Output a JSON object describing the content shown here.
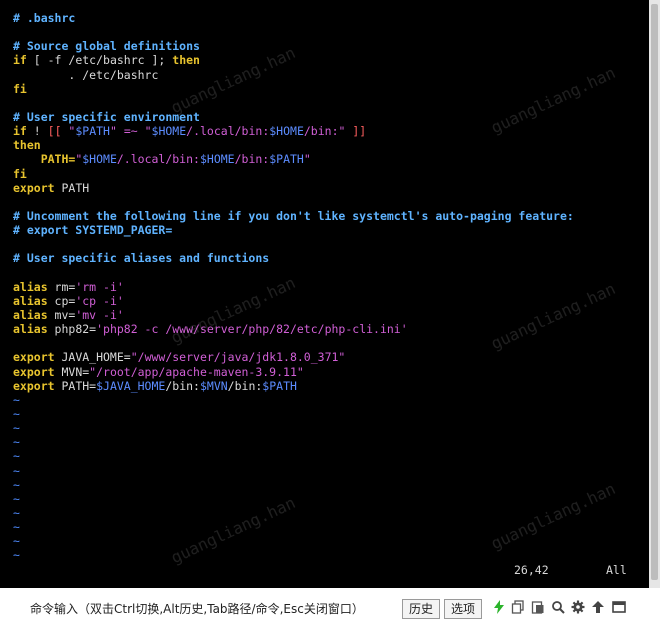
{
  "editor": {
    "lines": [
      [
        {
          "t": "# .bashrc",
          "c": "c-comment"
        }
      ],
      [],
      [
        {
          "t": "# Source global definitions",
          "c": "c-comment"
        }
      ],
      [
        {
          "t": "if",
          "c": "c-kw"
        },
        {
          "t": " [ -f /etc/bashrc ]; ",
          "c": "c-plain"
        },
        {
          "t": "then",
          "c": "c-kw"
        }
      ],
      [
        {
          "t": "        . /etc/bashrc",
          "c": "c-plain"
        }
      ],
      [
        {
          "t": "fi",
          "c": "c-kw"
        }
      ],
      [],
      [
        {
          "t": "# User specific environment",
          "c": "c-comment"
        }
      ],
      [
        {
          "t": "if",
          "c": "c-kw"
        },
        {
          "t": " ! ",
          "c": "c-plain"
        },
        {
          "t": "[[",
          "c": "c-red"
        },
        {
          "t": " \"",
          "c": "c-str"
        },
        {
          "t": "$PATH",
          "c": "c-var"
        },
        {
          "t": "\" =~ \"",
          "c": "c-str"
        },
        {
          "t": "$HOME",
          "c": "c-var"
        },
        {
          "t": "/.local/bin:",
          "c": "c-str"
        },
        {
          "t": "$HOME",
          "c": "c-var"
        },
        {
          "t": "/bin:\" ",
          "c": "c-str"
        },
        {
          "t": "]]",
          "c": "c-red"
        }
      ],
      [
        {
          "t": "then",
          "c": "c-kw"
        }
      ],
      [
        {
          "t": "    PATH=",
          "c": "c-kw"
        },
        {
          "t": "\"",
          "c": "c-str"
        },
        {
          "t": "$HOME",
          "c": "c-var"
        },
        {
          "t": "/.local/bin:",
          "c": "c-str"
        },
        {
          "t": "$HOME",
          "c": "c-var"
        },
        {
          "t": "/bin:",
          "c": "c-str"
        },
        {
          "t": "$PATH",
          "c": "c-var"
        },
        {
          "t": "\"",
          "c": "c-str"
        }
      ],
      [
        {
          "t": "fi",
          "c": "c-kw"
        }
      ],
      [
        {
          "t": "export",
          "c": "c-kw"
        },
        {
          "t": " PATH",
          "c": "c-plain"
        }
      ],
      [],
      [
        {
          "t": "# Uncomment the following line if you don't like systemctl's auto-paging feature:",
          "c": "c-comment"
        }
      ],
      [
        {
          "t": "# export SYSTEMD_PAGER=",
          "c": "c-comment"
        }
      ],
      [],
      [
        {
          "t": "# User specific aliases and functions",
          "c": "c-comment"
        }
      ],
      [],
      [
        {
          "t": "alias",
          "c": "c-kw"
        },
        {
          "t": " rm=",
          "c": "c-plain"
        },
        {
          "t": "'rm -i'",
          "c": "c-str"
        }
      ],
      [
        {
          "t": "alias",
          "c": "c-kw"
        },
        {
          "t": " cp=",
          "c": "c-plain"
        },
        {
          "t": "'cp -i'",
          "c": "c-str"
        }
      ],
      [
        {
          "t": "alias",
          "c": "c-kw"
        },
        {
          "t": " mv=",
          "c": "c-plain"
        },
        {
          "t": "'mv -i'",
          "c": "c-str"
        }
      ],
      [
        {
          "t": "alias",
          "c": "c-kw"
        },
        {
          "t": " php82=",
          "c": "c-plain"
        },
        {
          "t": "'php82 -c /www/server/php/82/etc/php-cli.ini'",
          "c": "c-str"
        }
      ],
      [],
      [
        {
          "t": "export",
          "c": "c-kw"
        },
        {
          "t": " JAVA_HOME=",
          "c": "c-plain"
        },
        {
          "t": "\"/www/server/java/jdk1.8.0_371\"",
          "c": "c-str"
        }
      ],
      [
        {
          "t": "export",
          "c": "c-kw"
        },
        {
          "t": " MVN=",
          "c": "c-plain"
        },
        {
          "t": "\"/root/app/apache-maven-3.9.11\"",
          "c": "c-str"
        }
      ],
      [
        {
          "t": "export",
          "c": "c-kw"
        },
        {
          "t": " PATH=",
          "c": "c-plain"
        },
        {
          "t": "$JAVA_HOME",
          "c": "c-var"
        },
        {
          "t": "/bin:",
          "c": "c-plain"
        },
        {
          "t": "$MVN",
          "c": "c-var"
        },
        {
          "t": "/bin:",
          "c": "c-plain"
        },
        {
          "t": "$PATH",
          "c": "c-var"
        }
      ],
      [
        {
          "t": "~",
          "c": "c-tilde"
        }
      ],
      [
        {
          "t": "~",
          "c": "c-tilde"
        }
      ],
      [
        {
          "t": "~",
          "c": "c-tilde"
        }
      ],
      [
        {
          "t": "~",
          "c": "c-tilde"
        }
      ],
      [
        {
          "t": "~",
          "c": "c-tilde"
        }
      ],
      [
        {
          "t": "~",
          "c": "c-tilde"
        }
      ],
      [
        {
          "t": "~",
          "c": "c-tilde"
        }
      ],
      [
        {
          "t": "~",
          "c": "c-tilde"
        }
      ],
      [
        {
          "t": "~",
          "c": "c-tilde"
        }
      ],
      [
        {
          "t": "~",
          "c": "c-tilde"
        }
      ],
      [
        {
          "t": "~",
          "c": "c-tilde"
        }
      ],
      [
        {
          "t": "~",
          "c": "c-tilde"
        }
      ]
    ]
  },
  "status": {
    "cursor": "26,42",
    "scroll": "All"
  },
  "watermark": "guangliang.han",
  "footer": {
    "hint": "命令输入（双击Ctrl切换,Alt历史,Tab路径/命令,Esc关闭窗口）",
    "history_button": "历史",
    "options_button": "选项",
    "icons": [
      "lightning-icon",
      "copy-icon",
      "paste-icon",
      "search-icon",
      "gear-icon",
      "arrow-up-icon",
      "window-icon"
    ]
  },
  "colors": {
    "comment": "#5fb3ff",
    "keyword": "#e8c42e",
    "string": "#d15fd6",
    "variable": "#5c8cff",
    "bracket": "#ff5f5f",
    "tilde": "#4f8cff"
  }
}
